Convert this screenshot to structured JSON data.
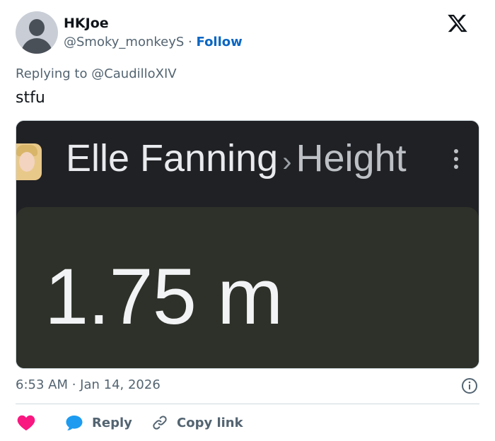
{
  "author": {
    "display_name": "HKJoe",
    "handle": "@Smoky_monkeyS",
    "separator": "·",
    "follow_label": "Follow"
  },
  "reply_context": "Replying to @CaudilloXIV",
  "tweet_text": "stfu",
  "media": {
    "entity": "Elle Fanning",
    "separator": "›",
    "attribute": "Height",
    "answer": "1.75 m"
  },
  "timestamp": "6:53 AM · Jan 14, 2026",
  "actions": {
    "reply_label": "Reply",
    "copy_link_label": "Copy link"
  },
  "colors": {
    "link_blue": "#0a66c2",
    "heart_pink": "#f91880",
    "reply_blue": "#1d9bf0",
    "muted_gray": "#536471"
  },
  "icons": [
    "x-logo-icon",
    "info-icon",
    "heart-icon",
    "reply-bubble-icon",
    "link-icon",
    "kebab-menu-icon"
  ]
}
